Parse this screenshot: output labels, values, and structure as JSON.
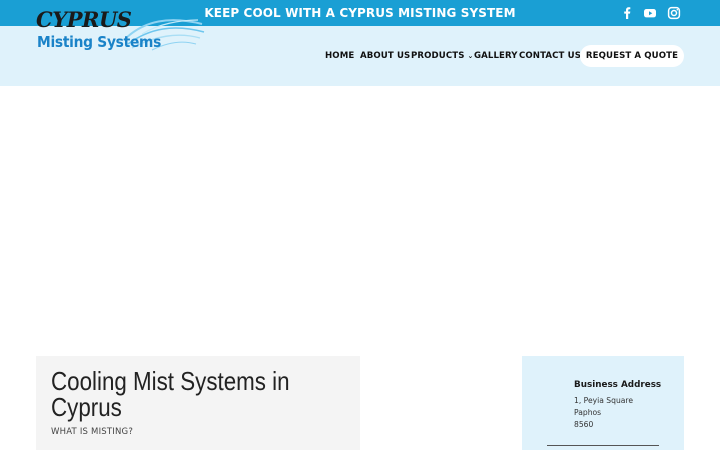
{
  "topbar": {
    "text": "KEEP COOL WITH A CYPRUS MISTING SYSTEM",
    "background": "#1a9fd4",
    "social": [
      "facebook-icon",
      "youtube-icon",
      "instagram-icon"
    ]
  },
  "logo": {
    "line1": "CYPRUS",
    "line2": "Misting Systems"
  },
  "nav": {
    "home": "HOME",
    "about": "ABOUT US",
    "products": "PRODUCTS",
    "gallery": "GALLERY",
    "contact": "CONTACT US",
    "quote": "REQUEST A QUOTE"
  },
  "header": {
    "background": "#dff2fb"
  },
  "main": {
    "title": "Cooling Mist Systems in Cyprus",
    "subtitle": "WHAT IS MISTING?"
  },
  "address": {
    "title": "Business Address",
    "line1": "1, Peyia Square",
    "line2": "Paphos",
    "line3": "8560"
  }
}
